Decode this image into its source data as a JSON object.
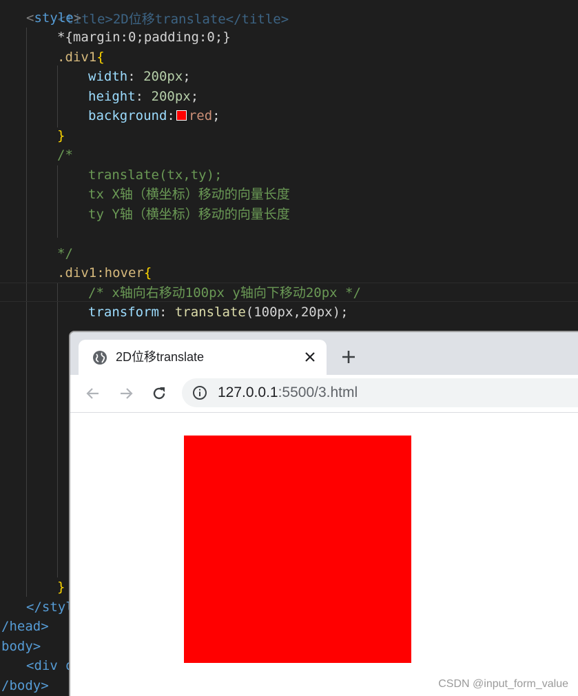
{
  "editor": {
    "lines": {
      "l0": "<title>2D位移translate</title>",
      "l1_open": "<",
      "l1_name": "style",
      "l1_close": ">",
      "l2": "*{margin:0;padding:0;}",
      "l3_sel": ".div1",
      "l3_brace": "{",
      "l4_prop": "width",
      "l4_val": "200px",
      "l5_prop": "height",
      "l5_val": "200px",
      "l6_prop": "background",
      "l6_val": "red",
      "l7": "}",
      "l8": "/*",
      "l9": "translate(tx,ty);",
      "l10": "tx X轴（横坐标）移动的向量长度",
      "l11": "ty Y轴（横坐标）移动的向量长度",
      "l13": "*/",
      "l14_sel": ".div1:hover",
      "l14_brace": "{",
      "l15": "/* x轴向右移动100px y轴向下移动20px */",
      "l16_prop": "transform",
      "l16_fn": "translate",
      "l16_args": "(100px,20px)",
      "l30": "}",
      "l31": "</styl",
      "l32": "/head>",
      "l33": "body>",
      "l34": "<div d",
      "l35": "/body>"
    },
    "swatch_color": "#ff0000"
  },
  "browser": {
    "tab_title": "2D位移translate",
    "url_host": "127.0.0.1",
    "url_rest": ":5500/3.html",
    "box_color": "#ff0000"
  },
  "watermark": "CSDN @input_form_value"
}
